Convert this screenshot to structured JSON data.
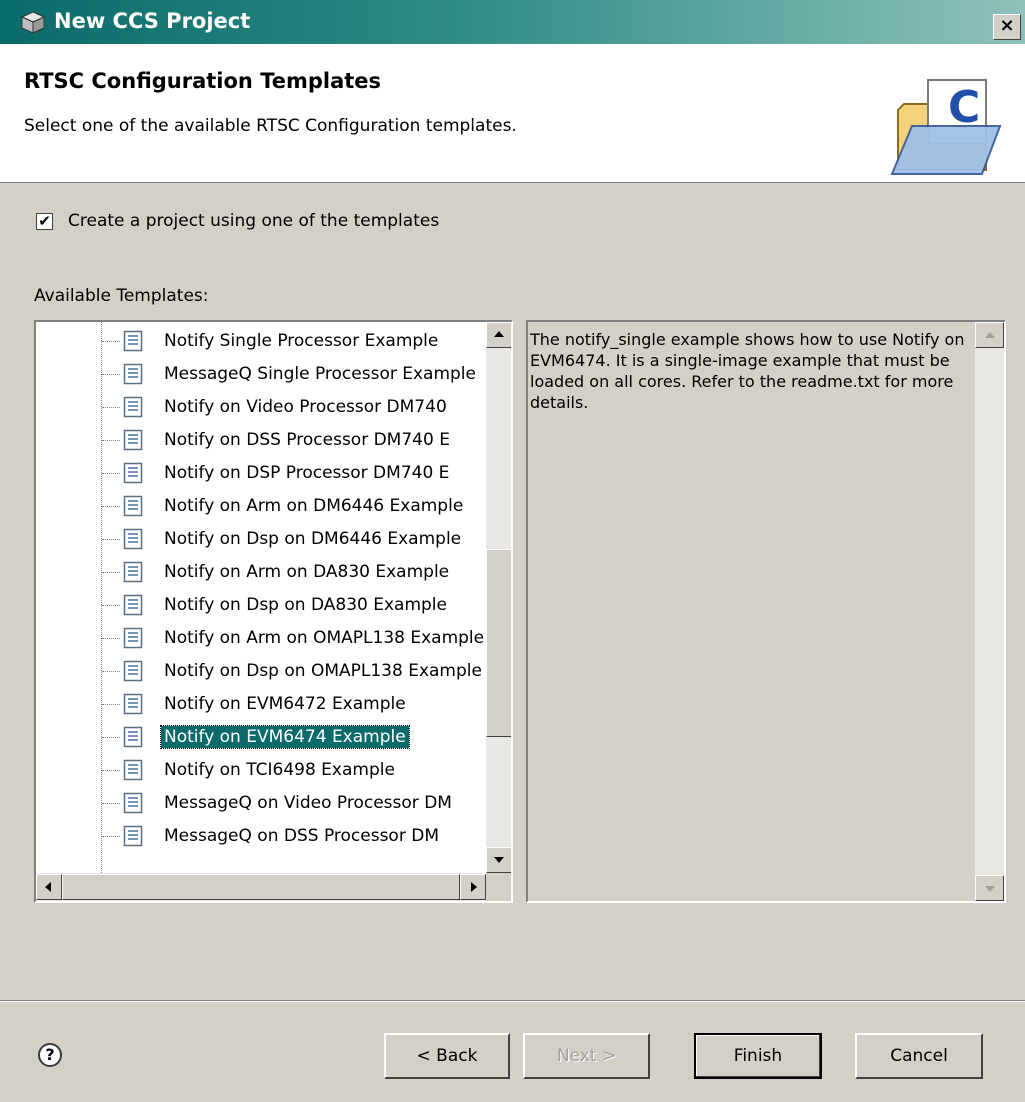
{
  "window": {
    "title": "New CCS Project",
    "close_label": "×"
  },
  "header": {
    "title": "RTSC Configuration Templates",
    "description": "Select one of the available RTSC Configuration templates."
  },
  "create_checkbox": {
    "label": "Create a project using one of the templates",
    "checked": true,
    "mark": "✔"
  },
  "available_label": "Available Templates:",
  "templates": [
    "Notify Single Processor Example",
    "MessageQ Single Processor Example",
    "Notify on Video Processor DM740",
    "Notify on DSS Processor DM740 E",
    "Notify on DSP Processor DM740 E",
    "Notify on Arm on DM6446 Example",
    "Notify on Dsp on DM6446 Example",
    "Notify on Arm on DA830 Example",
    "Notify on Dsp on DA830 Example",
    "Notify on Arm on OMAPL138 Example",
    "Notify on Dsp on OMAPL138 Example",
    "Notify on EVM6472 Example",
    "Notify on EVM6474 Example",
    "Notify on TCI6498 Example",
    "MessageQ on Video Processor DM",
    "MessageQ on DSS Processor DM"
  ],
  "selected_index": 12,
  "description_text": "The notify_single example shows how to use Notify on EVM6474. It is a single-image example that must be loaded on all cores. Refer to the readme.txt for more details.",
  "buttons": {
    "help": "?",
    "back": "< Back",
    "next": "Next >",
    "finish": "Finish",
    "cancel": "Cancel"
  },
  "icons": {
    "title": "ccs-project-icon",
    "header": "folder-c-icon",
    "template": "document-icon"
  }
}
